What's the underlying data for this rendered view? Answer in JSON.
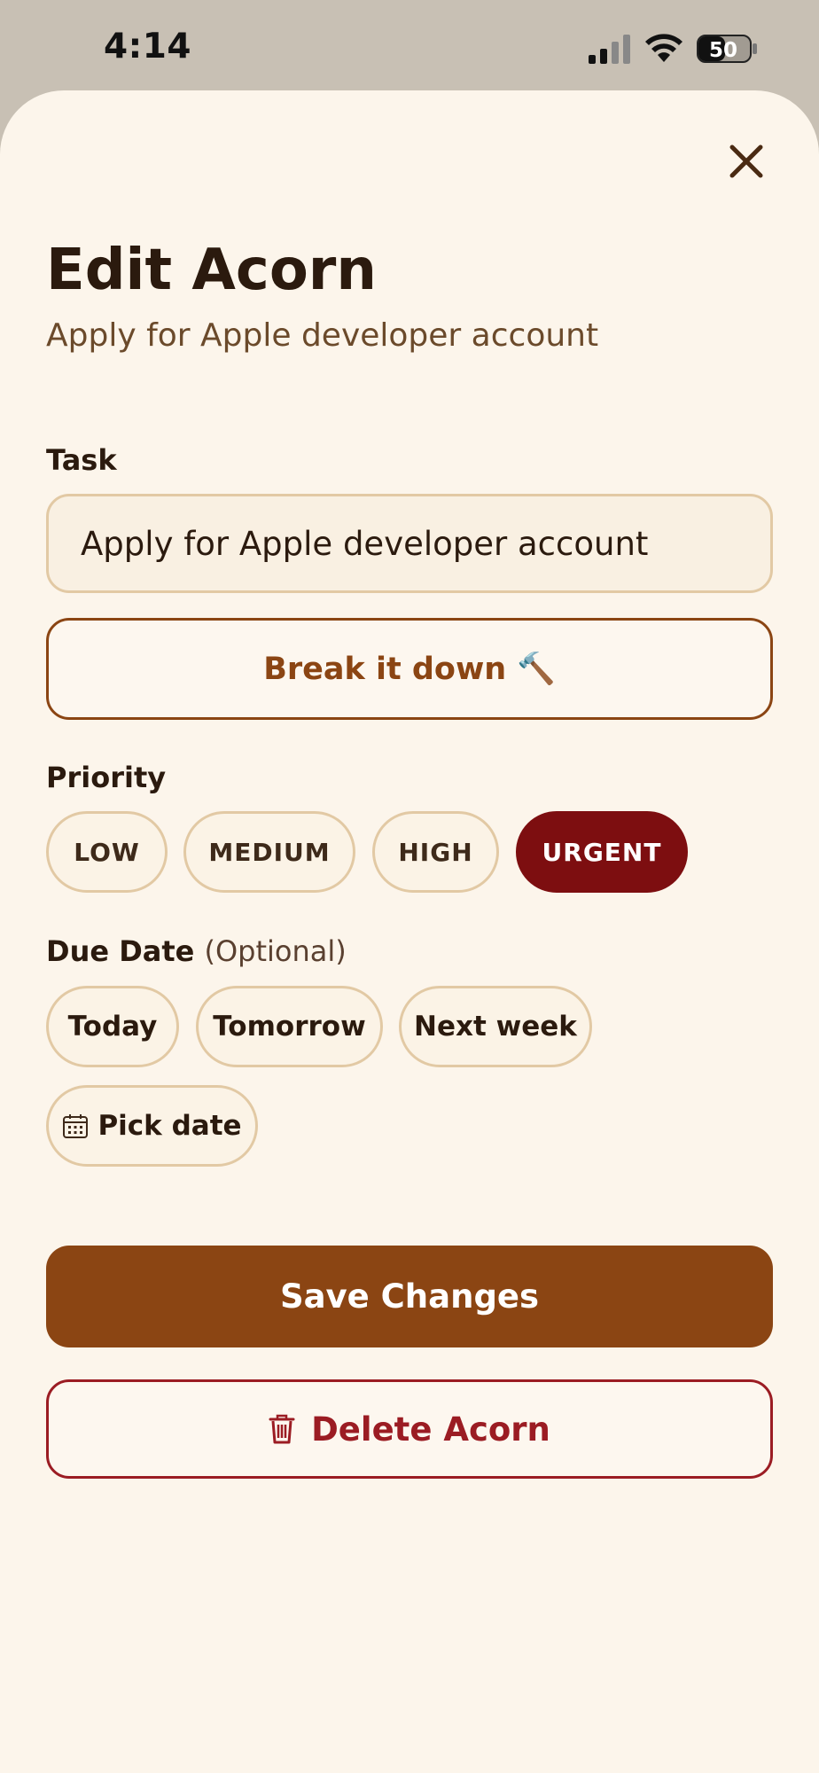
{
  "status_bar": {
    "time": "4:14",
    "battery_level": "50"
  },
  "sheet": {
    "title": "Edit Acorn",
    "subtitle": "Apply for Apple developer account"
  },
  "task": {
    "label": "Task",
    "value": "Apply for Apple developer account"
  },
  "breakdown": {
    "label": "Break it down",
    "emoji": "🔨"
  },
  "priority": {
    "label": "Priority",
    "options": [
      "LOW",
      "MEDIUM",
      "HIGH",
      "URGENT"
    ],
    "selected": "URGENT"
  },
  "due_date": {
    "label": "Due Date",
    "optional": "(Optional)",
    "options": [
      "Today",
      "Tomorrow",
      "Next week"
    ],
    "pick_label": "Pick date"
  },
  "actions": {
    "save_label": "Save Changes",
    "delete_label": "Delete Acorn"
  },
  "colors": {
    "accent": "#8b4513",
    "urgent": "#7d0e10",
    "danger": "#9b1c23",
    "background": "#fcf5eb"
  }
}
